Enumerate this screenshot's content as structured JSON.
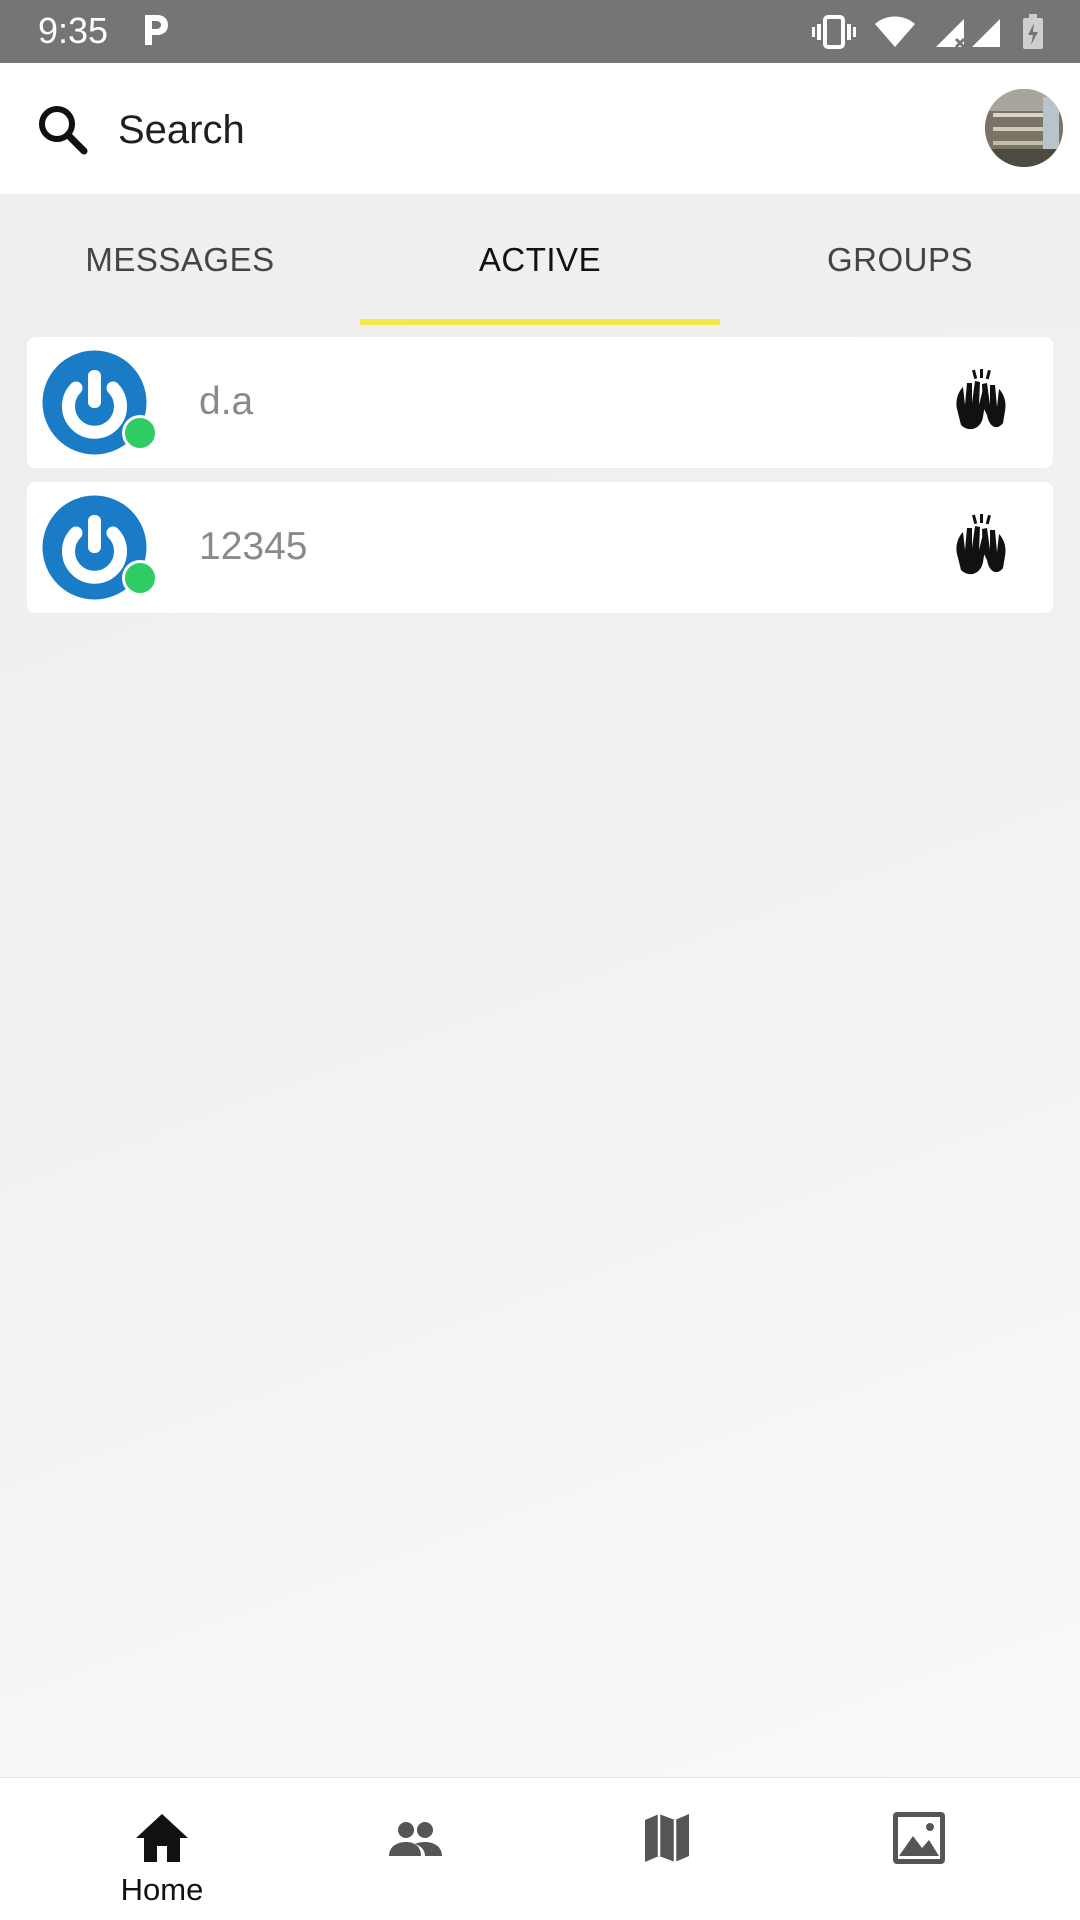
{
  "status_bar": {
    "time": "9:35"
  },
  "header": {
    "search_label": "Search",
    "search_icon": "search-icon",
    "profile_icon": "avatar"
  },
  "tabs": [
    {
      "label": "MESSAGES",
      "active": false
    },
    {
      "label": "ACTIVE",
      "active": true
    },
    {
      "label": "GROUPS",
      "active": false
    }
  ],
  "active_users": [
    {
      "name": "d.a",
      "online": true,
      "action_icon": "wave-hands-icon"
    },
    {
      "name": "12345",
      "online": true,
      "action_icon": "wave-hands-icon"
    }
  ],
  "bottom_nav": [
    {
      "label": "Home",
      "icon": "home-icon",
      "active": true
    },
    {
      "label": "",
      "icon": "people-icon",
      "active": false
    },
    {
      "label": "",
      "icon": "map-icon",
      "active": false
    },
    {
      "label": "",
      "icon": "image-icon",
      "active": false
    }
  ],
  "colors": {
    "status_bar": "#757575",
    "tab_indicator": "#f3e84a",
    "online": "#2ecc63",
    "logo_blue": "#1a7bc6"
  }
}
